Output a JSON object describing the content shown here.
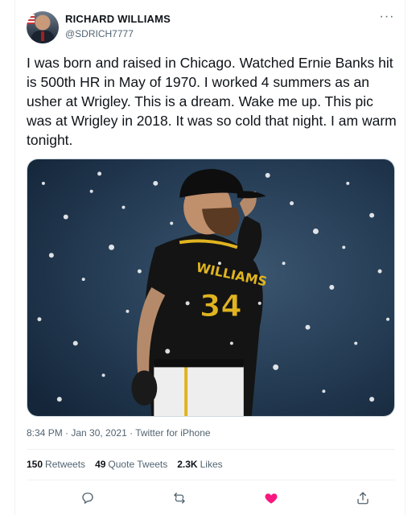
{
  "author": {
    "display_name": "RICHARD WILLIAMS",
    "handle": "@SDRICH7777"
  },
  "more_icon": "more-dots-icon",
  "tweet": {
    "text": "I was born and raised in Chicago. Watched Ernie Banks hit is 500th HR in May of 1970. I worked 4 summers as an usher at Wrigley. This is a dream. Wake me up.  This pic was at Wrigley in 2018. It was so cold that night.  I am warm tonight.",
    "timestamp": "8:34 PM · Jan 30, 2021 · Twitter for iPhone"
  },
  "photo": {
    "jersey_name": "WILLIAMS",
    "jersey_number": "34"
  },
  "stats": {
    "retweets_count": "150",
    "retweets_label": "Retweets",
    "quotes_count": "49",
    "quotes_label": "Quote Tweets",
    "likes_count": "2.3K",
    "likes_label": "Likes"
  },
  "actions": {
    "reply_icon": "reply-icon",
    "retweet_icon": "retweet-icon",
    "like_icon": "heart-icon",
    "share_icon": "share-icon",
    "like_color": "#f91880"
  },
  "colors": {
    "text": "#0f1419",
    "secondary": "#536471",
    "border": "#eff3f4"
  }
}
